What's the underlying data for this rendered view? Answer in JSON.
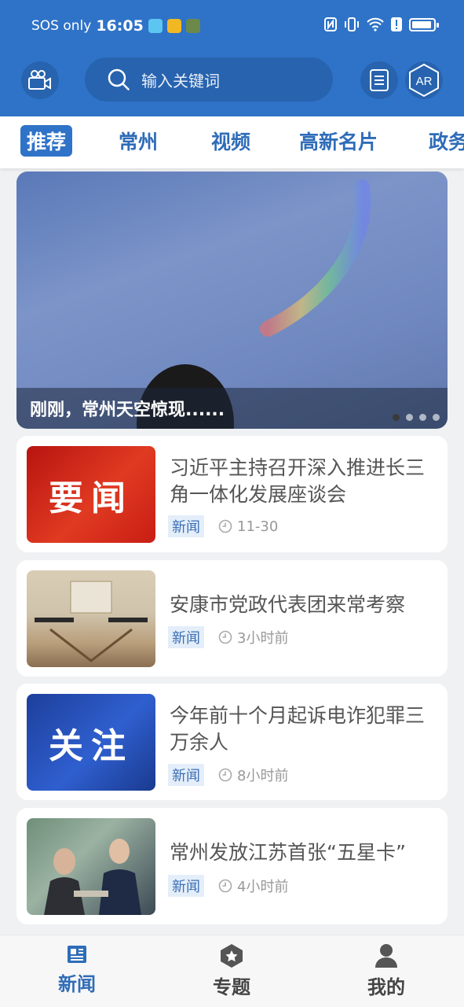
{
  "status_bar": {
    "carrier": "SOS only",
    "time": "16:05"
  },
  "header": {
    "search_placeholder": "输入关键词",
    "ar_label": "AR"
  },
  "tabs": [
    {
      "label": "推荐",
      "active": true
    },
    {
      "label": "常州",
      "active": false
    },
    {
      "label": "视频",
      "active": false
    },
    {
      "label": "高新名片",
      "active": false
    },
    {
      "label": "政务",
      "active": false
    }
  ],
  "banner": {
    "title": "刚刚，常州天空惊现......"
  },
  "news": [
    {
      "title": "习近平主持召开深入推进长三角一体化发展座谈会",
      "tag": "新闻",
      "time": "11-30",
      "thumb_text": "要闻"
    },
    {
      "title": "安康市党政代表团来常考察",
      "tag": "新闻",
      "time": "3小时前",
      "thumb_text": ""
    },
    {
      "title": "今年前十个月起诉电诈犯罪三万余人",
      "tag": "新闻",
      "time": "8小时前",
      "thumb_text": "关注"
    },
    {
      "title": "常州发放江苏首张“五星卡”",
      "tag": "新闻",
      "time": "4小时前",
      "thumb_text": ""
    }
  ],
  "bottom_nav": [
    {
      "label": "新闻",
      "icon": "newspaper-icon",
      "active": true
    },
    {
      "label": "专题",
      "icon": "star-badge-icon",
      "active": false
    },
    {
      "label": "我的",
      "icon": "person-icon",
      "active": false
    }
  ],
  "colors": {
    "brand": "#2f73c8",
    "tab_text": "#2f6cb8"
  }
}
